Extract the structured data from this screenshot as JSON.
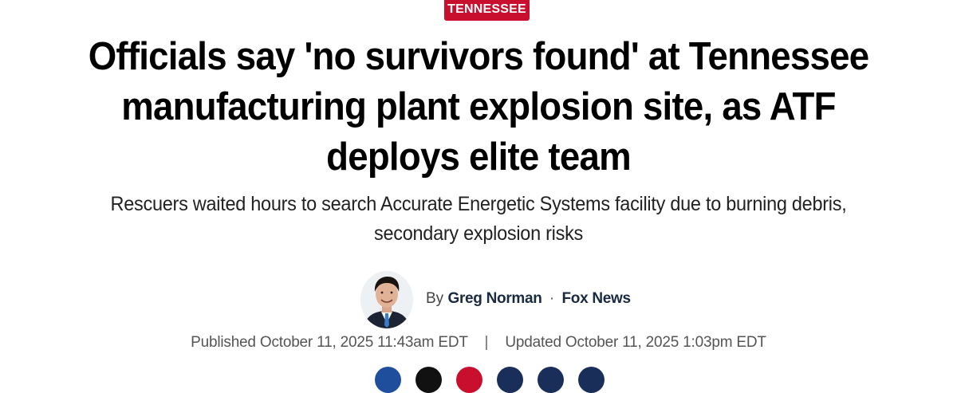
{
  "category": {
    "label": "TENNESSEE",
    "color": "#c8102e"
  },
  "article": {
    "headline": "Officials say 'no survivors found' at Tennessee manufacturing plant explosion site, as ATF deploys elite team",
    "subheadline": "Rescuers waited hours to search Accurate Energetic Systems facility due to burning debris, secondary explosion risks"
  },
  "byline": {
    "by": "By",
    "author": "Greg Norman",
    "separator": "·",
    "source": "Fox News"
  },
  "dates": {
    "published": "Published October 11, 2025 11:43am EDT",
    "separator": "|",
    "updated": "Updated October 11, 2025 1:03pm EDT"
  },
  "share": {
    "buttons": [
      {
        "icon": "facebook-icon",
        "color": "#1f4e9c"
      },
      {
        "icon": "x-twitter-icon",
        "color": "#111111"
      },
      {
        "icon": "flipboard-icon",
        "color": "#c8102e"
      },
      {
        "icon": "comments-icon",
        "color": "#1a2e5a"
      },
      {
        "icon": "print-icon",
        "color": "#1a2e5a"
      },
      {
        "icon": "email-icon",
        "color": "#1a2e5a"
      }
    ]
  }
}
